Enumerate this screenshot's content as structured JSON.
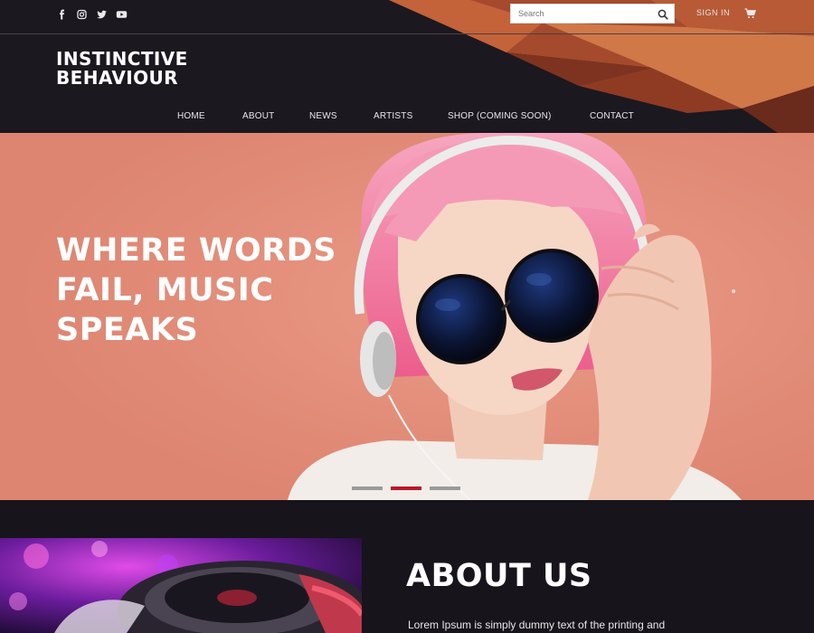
{
  "header": {
    "social_icons": [
      "facebook-icon",
      "instagram-icon",
      "twitter-icon",
      "youtube-icon"
    ],
    "search": {
      "placeholder": "Search",
      "value": ""
    },
    "signin_label": "SIGN IN",
    "cart_icon": "cart-icon",
    "logo": {
      "line1": "INSTINCTIVE",
      "line2": "BEHAVIOUR"
    },
    "nav": [
      "HOME",
      "ABOUT",
      "NEWS",
      "ARTISTS",
      "SHOP (COMING SOON)",
      "CONTACT"
    ]
  },
  "hero": {
    "title": "WHERE WORDS FAIL, MUSIC SPEAKS",
    "slides": 3,
    "active_slide": 2
  },
  "about": {
    "title": "ABOUT US",
    "text": "Lorem Ipsum is simply dummy text of the printing and"
  },
  "colors": {
    "header_bg": "#1b1820",
    "hero_bg": "#e58e7a",
    "accent": "#b5182a",
    "page_bg": "#16131a"
  }
}
